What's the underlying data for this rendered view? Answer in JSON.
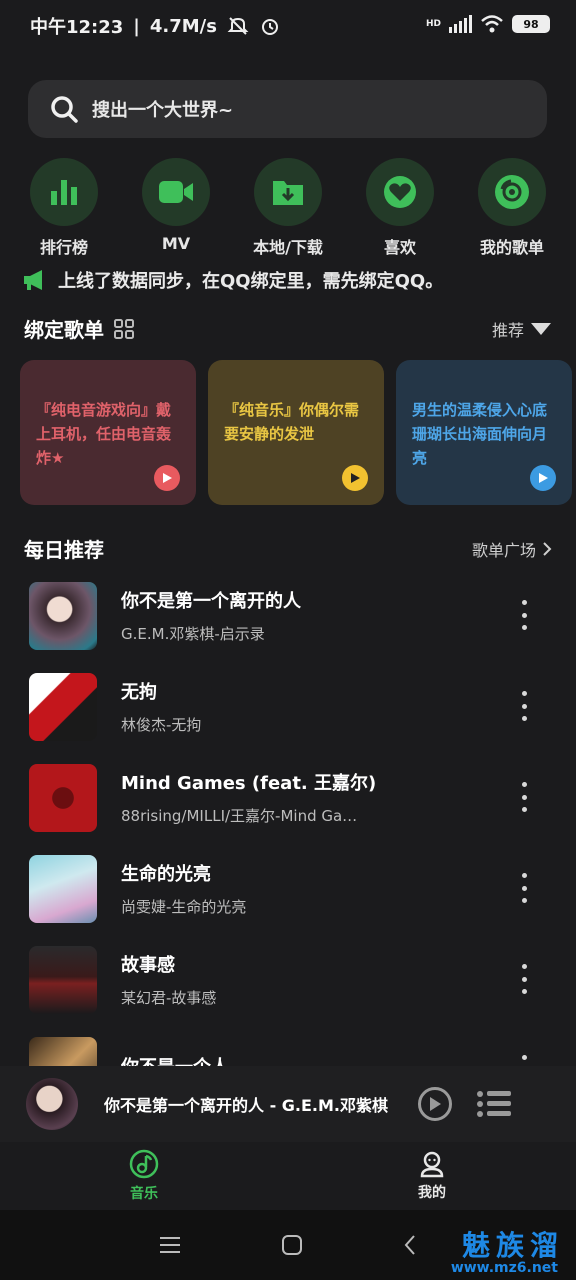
{
  "status_bar": {
    "time": "中午12:23",
    "speed": "4.7M/s",
    "network": "HD",
    "battery": "98"
  },
  "search": {
    "placeholder": "搜出一个大世界~"
  },
  "quick_nav": [
    {
      "label": "排行榜",
      "icon": "chart-icon"
    },
    {
      "label": "MV",
      "icon": "video-icon"
    },
    {
      "label": "本地/下载",
      "icon": "folder-download-icon"
    },
    {
      "label": "喜欢",
      "icon": "heart-icon"
    },
    {
      "label": "我的歌单",
      "icon": "disc-icon"
    }
  ],
  "notice": {
    "line1": "上线了数据同步，在QQ绑定里，需先绑定QQ。"
  },
  "bound_playlists": {
    "title": "绑定歌单",
    "sort_label": "推荐",
    "cards": [
      {
        "text": "『纯电音游戏向』戴上耳机，任由电音轰炸★",
        "bg": "#4a2a30",
        "fg": "#e0626a",
        "play_color": "#e85a5f"
      },
      {
        "text": "『纯音乐』你偶尔需要安静的发泄",
        "bg": "#4e4224",
        "fg": "#e9c643",
        "play_color": "#f2c230"
      },
      {
        "text": "男生的温柔侵入心底 珊瑚长出海面伸向月亮",
        "bg": "#243647",
        "fg": "#4ea6e8",
        "play_color": "#3c9be2"
      }
    ]
  },
  "daily": {
    "title": "每日推荐",
    "more_label": "歌单广场",
    "songs": [
      {
        "title": "你不是第一个离开的人",
        "subtitle": "G.E.M.邓紫棋-启示录"
      },
      {
        "title": "无拘",
        "subtitle": "林俊杰-无拘"
      },
      {
        "title": "Mind Games (feat. 王嘉尔)",
        "subtitle": "88rising/MILLI/王嘉尔-Mind Ga…"
      },
      {
        "title": "生命的光亮",
        "subtitle": "尚雯婕-生命的光亮"
      },
      {
        "title": "故事感",
        "subtitle": "某幻君-故事感"
      },
      {
        "title": "你不是一个人",
        "subtitle": ""
      }
    ]
  },
  "player": {
    "now_playing": "你不是第一个离开的人 - G.E.M.邓紫棋"
  },
  "tabs": [
    {
      "label": "音乐",
      "active": true
    },
    {
      "label": "我的",
      "active": false
    }
  ],
  "watermark": {
    "main": "魅族溜",
    "url": "www.mz6.net"
  },
  "colors": {
    "accent": "#3fbf5a",
    "background": "#1b1b1d"
  }
}
